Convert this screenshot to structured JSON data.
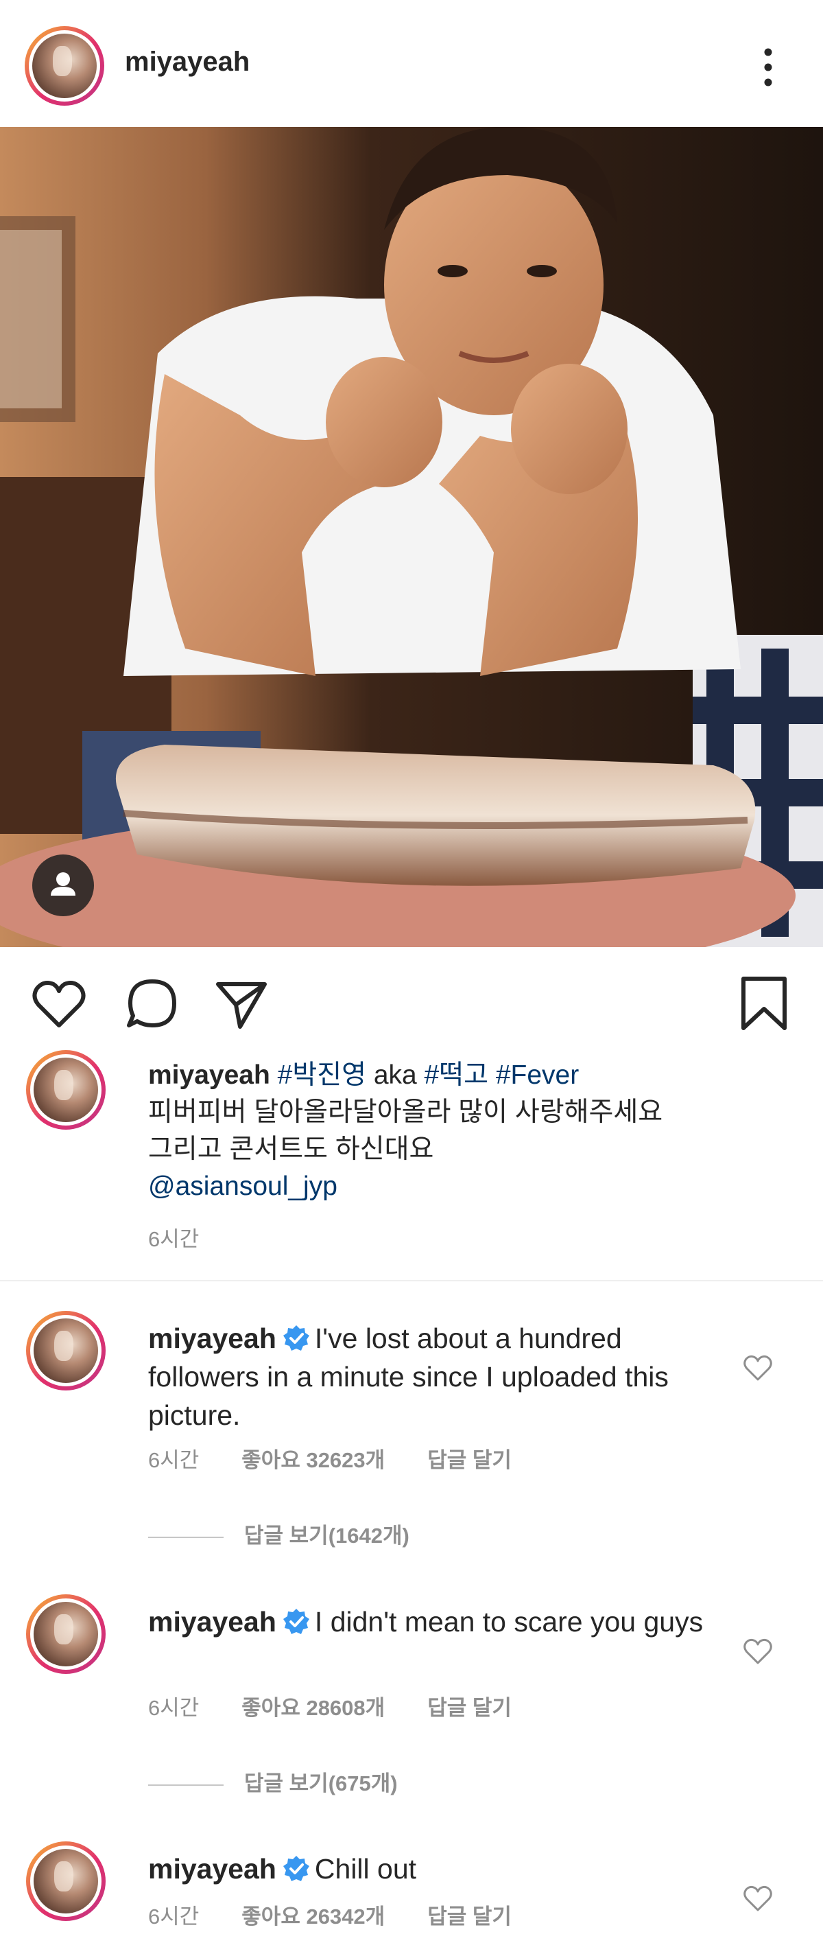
{
  "header": {
    "username": "miyayeah"
  },
  "post": {
    "caption": {
      "username": "miyayeah",
      "tag1": "#박진영",
      "aka": " aka ",
      "tag2": "#떡고",
      "tag3": "#Fever",
      "line2": "피버피버 달아올라달아올라 많이 사랑해주세요",
      "line3": "그리고 콘서트도 하신대요",
      "mention": "@asiansoul_jyp",
      "time": "6시간"
    }
  },
  "comments": [
    {
      "username": "miyayeah",
      "text": "I've lost about a hundred followers in a minute since I uploaded this picture.",
      "time": "6시간",
      "likes": "좋아요 32623개",
      "reply": "답글 달기",
      "view_replies": "답글 보기(1642개)"
    },
    {
      "username": "miyayeah",
      "text": "I didn't mean to scare you guys",
      "time": "6시간",
      "likes": "좋아요 28608개",
      "reply": "답글 달기",
      "view_replies": "답글 보기(675개)"
    },
    {
      "username": "miyayeah",
      "text": "Chill out",
      "time": "6시간",
      "likes": "좋아요 26342개",
      "reply": "답글 달기"
    }
  ],
  "colors": {
    "link": "#00376b",
    "verified": "#3897f0",
    "meta": "#8e8e8e"
  },
  "icons": [
    "more-vertical-icon",
    "user-tag-icon",
    "heart-icon",
    "comment-icon",
    "share-icon",
    "bookmark-icon",
    "verified-icon"
  ]
}
